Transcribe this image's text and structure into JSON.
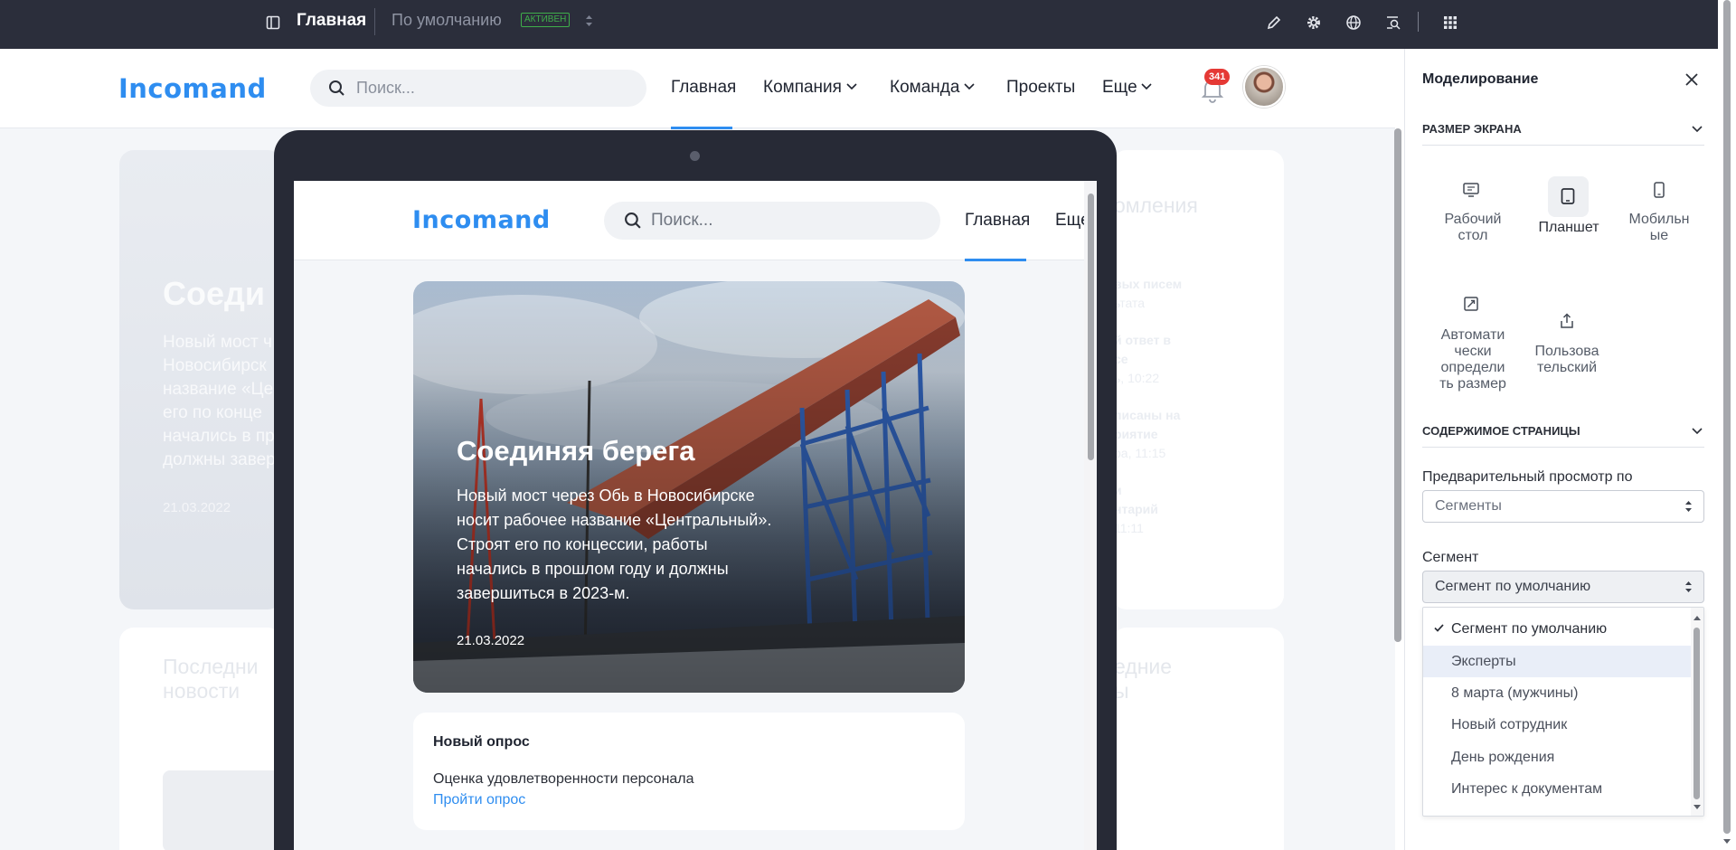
{
  "topbar": {
    "page_label": "Главная",
    "variant_label": "По умолчанию",
    "status_badge": "АКТИВЕН"
  },
  "site": {
    "logo": "Incomand",
    "search_placeholder": "Поиск...",
    "nav": [
      "Главная",
      "Компания",
      "Команда",
      "Проекты",
      "Еще"
    ],
    "notifications_count": "341"
  },
  "background": {
    "hero_title": "Соеди",
    "hero_text": [
      "Новый мост ч",
      "Новосибирск",
      "название «Це",
      "его по конце",
      "начались в пр",
      "должны завер"
    ],
    "hero_date": "21.03.2022",
    "right_heading": "омления",
    "right_items": [
      "вых писем",
      "ьтата",
      "й ответ в",
      "се",
      "ь, 10:22",
      "писаны на",
      "риятие",
      "ра, 11:15",
      "и",
      "нтарий",
      "11:11"
    ],
    "latest_news_1": "Последни",
    "latest_news_2": "новости",
    "right_latest_1": "едние",
    "right_latest_2": "ы"
  },
  "preview": {
    "logo": "Incomand",
    "search_placeholder": "Поиск...",
    "nav": [
      "Главная",
      "Еще"
    ],
    "hero": {
      "title": "Соединяя берега",
      "text_lines": [
        "Новый мост через Обь в Новосибирске",
        "носит рабочее название «Центральный».",
        "Строят его по концессии, работы",
        "начались в прошлом году и должны",
        "завершиться в 2023-м."
      ],
      "date": "21.03.2022"
    },
    "poll": {
      "title": "Новый опрос",
      "description": "Оценка удовлетворенности персонала",
      "link": "Пройти опрос"
    }
  },
  "panel": {
    "title": "Моделирование",
    "screen_size_section": "РАЗМЕР ЭКРАНА",
    "devices": [
      {
        "line1": "Рабочий",
        "line2": "стол"
      },
      {
        "line1": "Планшет"
      },
      {
        "line1": "Мобильн",
        "line2": "ые"
      },
      {
        "line1": "Автомати",
        "line2": "чески",
        "line3": "определи",
        "line4": "ть размер"
      },
      {
        "line1": "Пользова",
        "line2": "тельский"
      }
    ],
    "content_section": "СОДЕРЖИМОЕ СТРАНИЦЫ",
    "preview_label": "Предварительный просмотр по",
    "preview_value": "Сегменты",
    "segment_label": "Сегмент",
    "segment_value": "Сегмент по умолчанию",
    "segment_options": [
      "Сегмент по умолчанию",
      "Эксперты",
      "8 марта (мужчины)",
      "Новый сотрудник",
      "День рождения",
      "Интерес к документам"
    ],
    "selected_option": "Сегмент по умолчанию",
    "highlighted_option": "Эксперты"
  },
  "colors": {
    "topbar_bg": "#2b2e3b",
    "brand_blue": "#2e8df0",
    "badge_green": "#3fae4a",
    "notification_red": "#e53935",
    "device_frame": "#272a36"
  }
}
